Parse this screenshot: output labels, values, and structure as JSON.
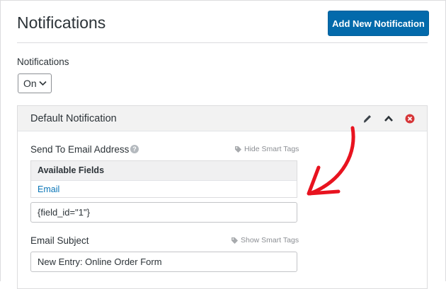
{
  "header": {
    "title": "Notifications",
    "add_button": "Add New Notification"
  },
  "notifications_toggle": {
    "label": "Notifications",
    "value": "On"
  },
  "panel": {
    "title": "Default Notification",
    "email_field": {
      "label": "Send To Email Address",
      "smart_tags_toggle": "Hide Smart Tags",
      "available_fields_title": "Available Fields",
      "available_fields": [
        "Email"
      ],
      "value": "{field_id=\"1\"}"
    },
    "subject_field": {
      "label": "Email Subject",
      "smart_tags_toggle": "Show Smart Tags",
      "value": "New Entry: Online Order Form"
    }
  },
  "icons": [
    "chevron-down-icon",
    "pencil-icon",
    "chevron-up-icon",
    "close-circle-icon",
    "help-icon",
    "tag-icon",
    "annotation-arrow"
  ],
  "colors": {
    "primary_button": "#036aab",
    "link": "#0a75b7",
    "delete": "#d63638",
    "annotation": "#e8131f"
  }
}
